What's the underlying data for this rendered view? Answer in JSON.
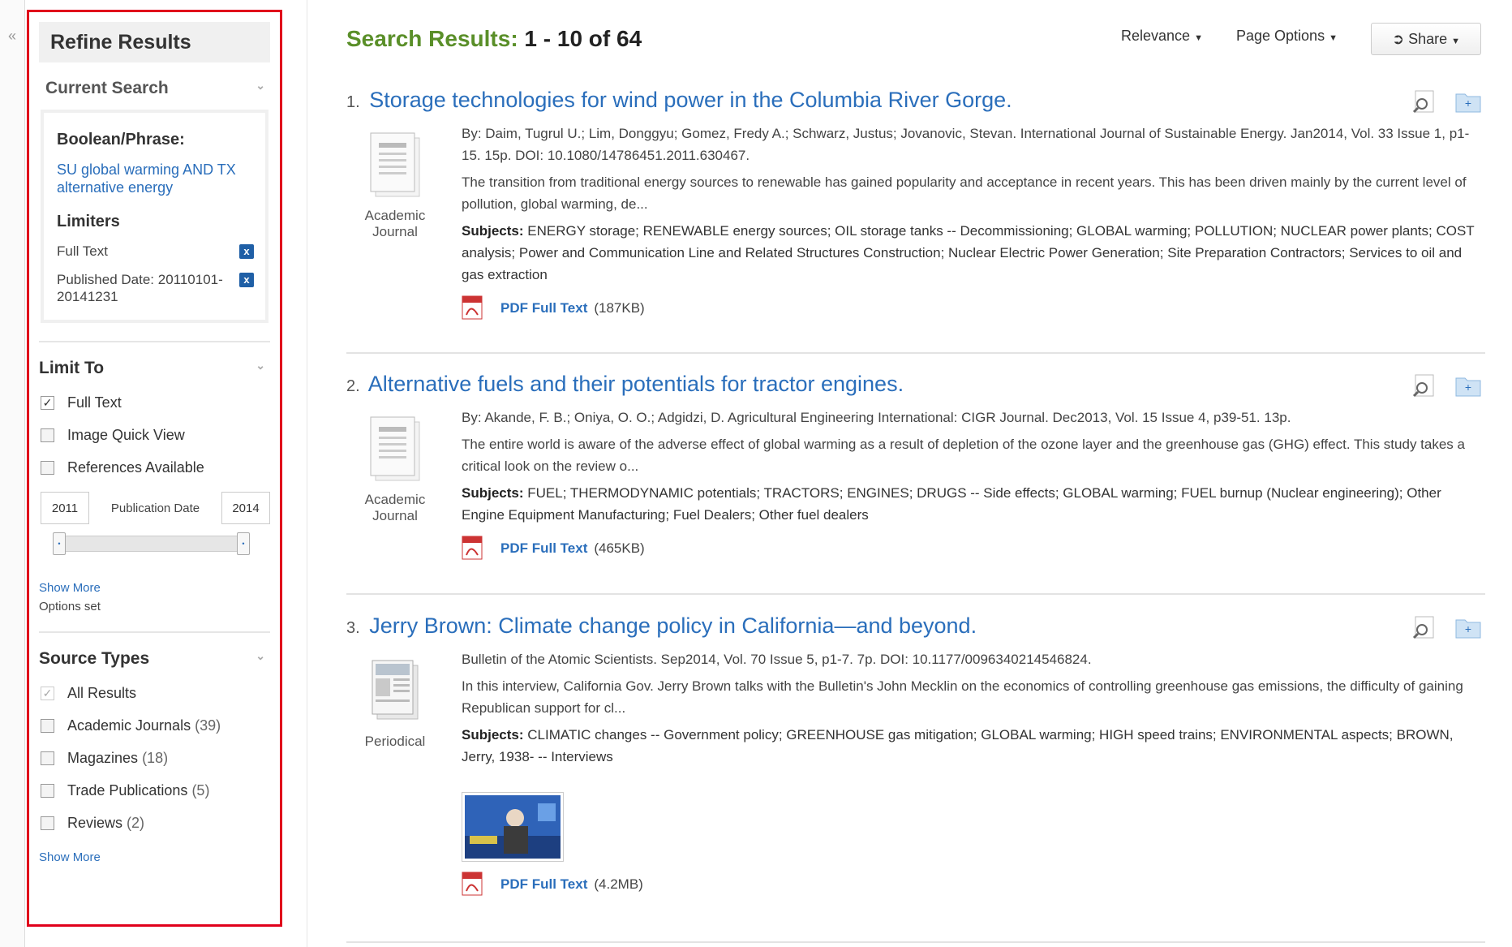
{
  "sidebar": {
    "collapse_glyph": "«",
    "refine_title": "Refine Results",
    "current_search": {
      "heading": "Current Search",
      "boolean_label": "Boolean/Phrase:",
      "search_terms": "SU global warming AND TX alternative energy",
      "limiters_label": "Limiters",
      "limiters": [
        {
          "label": "Full Text"
        },
        {
          "label": "Published Date: 20110101-20141231"
        }
      ],
      "remove_glyph": "x"
    },
    "limit_to": {
      "heading": "Limit To",
      "options": [
        {
          "label": "Full Text",
          "checked": true
        },
        {
          "label": "Image Quick View",
          "checked": false
        },
        {
          "label": "References Available",
          "checked": false
        }
      ],
      "date_from": "2011",
      "date_to": "2014",
      "date_label": "Publication Date",
      "show_more": "Show More",
      "options_set": "Options set"
    },
    "source_types": {
      "heading": "Source Types",
      "options": [
        {
          "label": "All Results",
          "count": "",
          "checked": true,
          "disabled": true
        },
        {
          "label": "Academic Journals",
          "count": "(39)",
          "checked": false
        },
        {
          "label": "Magazines",
          "count": "(18)",
          "checked": false
        },
        {
          "label": "Trade Publications",
          "count": "(5)",
          "checked": false
        },
        {
          "label": "Reviews",
          "count": "(2)",
          "checked": false
        }
      ],
      "show_more": "Show More"
    }
  },
  "header": {
    "results_label": "Search Results:",
    "results_range": "1 - 10 of 64",
    "relevance": "Relevance",
    "page_options": "Page Options",
    "share": "Share"
  },
  "results": [
    {
      "index": "1.",
      "title": "Storage technologies for wind power in the Columbia River Gorge.",
      "doc_type": "Academic Journal",
      "citation": "By: Daim, Tugrul U.; Lim, Donggyu; Gomez, Fredy A.; Schwarz, Justus; Jovanovic, Stevan. International Journal of Sustainable Energy. Jan2014, Vol. 33 Issue 1, p1-15. 15p. DOI: 10.1080/14786451.2011.630467.",
      "abstract": "The transition from traditional energy sources to renewable has gained popularity and acceptance in recent years. This has been driven mainly by the current level of pollution, global warming, de...",
      "subjects_label": "Subjects:",
      "subjects": "ENERGY storage; RENEWABLE energy sources; OIL storage tanks -- Decommissioning; GLOBAL warming; POLLUTION; NUCLEAR power plants; COST analysis; Power and Communication Line and Related Structures Construction; Nuclear Electric Power Generation; Site Preparation Contractors; Services to oil and gas extraction",
      "pdf_label": "PDF Full Text",
      "pdf_size": "(187KB)"
    },
    {
      "index": "2.",
      "title": "Alternative fuels and their potentials for tractor engines.",
      "doc_type": "Academic Journal",
      "citation": "By: Akande, F. B.; Oniya, O. O.; Adgidzi, D. Agricultural Engineering International: CIGR Journal. Dec2013, Vol. 15 Issue 4, p39-51. 13p.",
      "abstract": "The entire world is aware of the adverse effect of global warming as a result of depletion of the ozone layer and the greenhouse gas (GHG) effect. This study takes a critical look on the review o...",
      "subjects_label": "Subjects:",
      "subjects": "FUEL; THERMODYNAMIC potentials; TRACTORS; ENGINES; DRUGS -- Side effects; GLOBAL warming; FUEL burnup (Nuclear engineering); Other Engine Equipment Manufacturing; Fuel Dealers; Other fuel dealers",
      "pdf_label": "PDF Full Text",
      "pdf_size": "(465KB)"
    },
    {
      "index": "3.",
      "title": "Jerry Brown: Climate change policy in California—and beyond.",
      "doc_type": "Periodical",
      "citation": "Bulletin of the Atomic Scientists. Sep2014, Vol. 70 Issue 5, p1-7. 7p. DOI: 10.1177/0096340214546824.",
      "abstract": "In this interview, California Gov. Jerry Brown talks with the Bulletin's John Mecklin on the economics of controlling greenhouse gas emissions, the difficulty of gaining Republican support for cl...",
      "subjects_label": "Subjects:",
      "subjects": "CLIMATIC changes -- Government policy; GREENHOUSE gas mitigation; GLOBAL warming; HIGH speed trains; ENVIRONMENTAL aspects; BROWN, Jerry, 1938- -- Interviews",
      "pdf_label": "PDF Full Text",
      "pdf_size": "(4.2MB)"
    }
  ]
}
